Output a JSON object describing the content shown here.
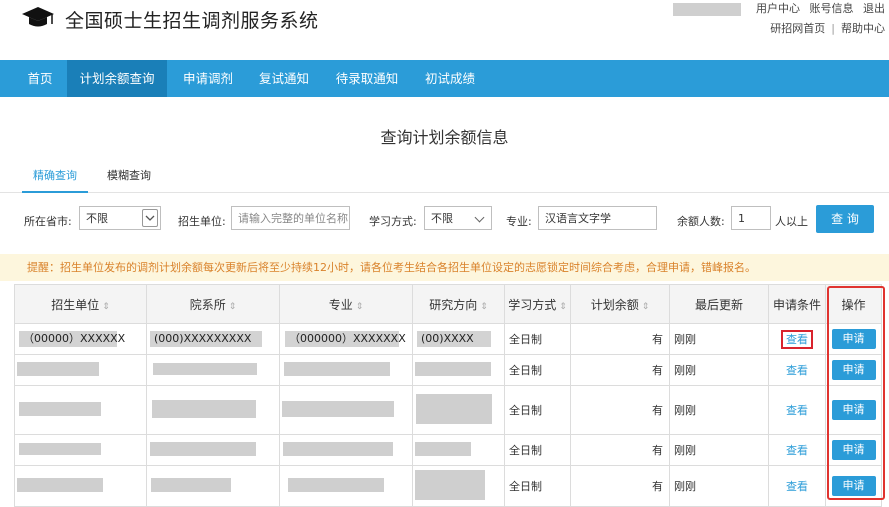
{
  "header": {
    "site_title": "全国硕士生招生调剂服务系统",
    "user_links": [
      "用户中心",
      "账号信息",
      "退出"
    ],
    "sub_links": [
      "研招网首页",
      "帮助中心"
    ],
    "sub_sep": "|"
  },
  "nav": {
    "items": [
      "首页",
      "计划余额查询",
      "申请调剂",
      "复试通知",
      "待录取通知",
      "初试成绩"
    ]
  },
  "page_title": "查询计划余额信息",
  "tabs": [
    "精确查询",
    "模糊查询"
  ],
  "filters": {
    "province_label": "所在省市:",
    "province_value": "不限",
    "unit_label": "招生单位:",
    "unit_placeholder": "请输入完整的单位名称",
    "mode_label": "学习方式:",
    "mode_value": "不限",
    "major_label": "专业:",
    "major_value": "汉语言文字学",
    "count_label": "余额人数:",
    "count_value": "1",
    "count_suffix": "人以上",
    "query_button": "查 询"
  },
  "notice": "提醒：招生单位发布的调剂计划余额每次更新后将至少持续12小时，请各位考生结合各招生单位设定的志愿锁定时间综合考虑，合理申请，错峰报名。",
  "table": {
    "headers": [
      "招生单位",
      "院系所",
      "专业",
      "研究方向",
      "学习方式",
      "计划余额",
      "最后更新",
      "申请条件",
      "操作"
    ],
    "first_row": {
      "unit": "（00000）XXXXXX",
      "dept": "(000)XXXXXXXXX",
      "major": "（000000）XXXXXXX",
      "direction": "(00)XXXX"
    },
    "common": {
      "mode": "全日制",
      "balance": "有",
      "updated": "刚刚",
      "condition": "查看",
      "action": "申请"
    }
  },
  "colors": {
    "nav_bg": "#2b9cd8",
    "nav_active": "#1a7fb8",
    "notice_text": "#d9822b",
    "highlight_red": "#e0332f"
  }
}
